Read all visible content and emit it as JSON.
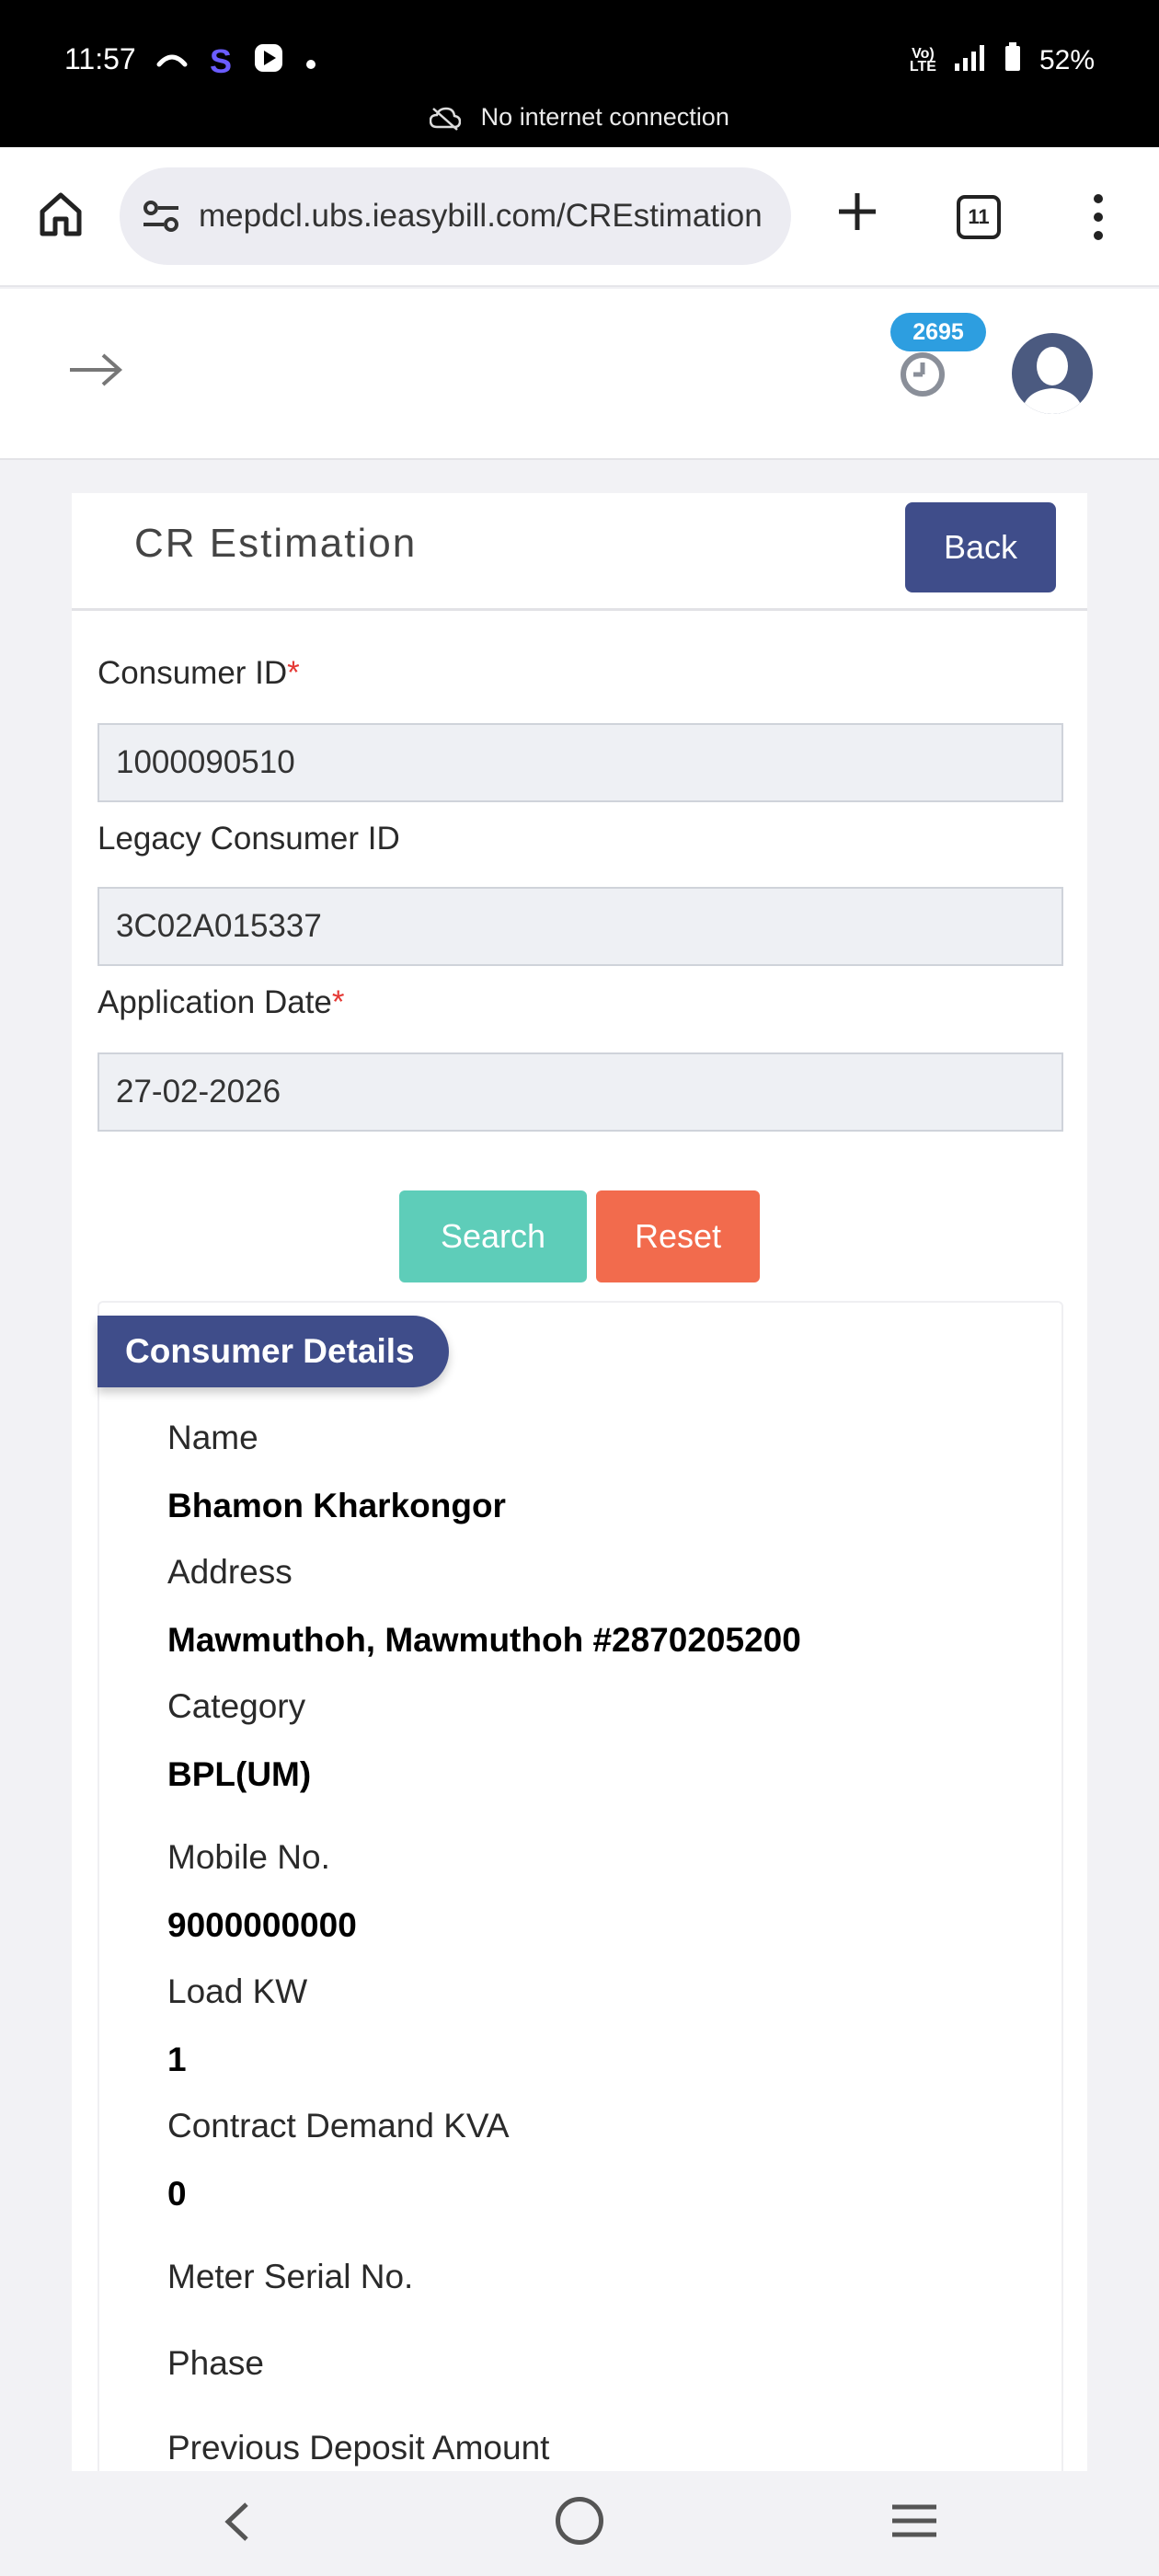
{
  "status_bar": {
    "time": "11:57",
    "battery": "52%",
    "network_notice": "No internet connection",
    "lte": "Vo) LTE"
  },
  "browser": {
    "url": "mepdcl.ubs.ieasybill.com/CREstimation",
    "tab_count": "11"
  },
  "header": {
    "notification_count": "2695"
  },
  "page": {
    "title": "CR Estimation",
    "back_label": "Back"
  },
  "form": {
    "consumer_id": {
      "label": "Consumer ID",
      "required_mark": "*",
      "value": "1000090510"
    },
    "legacy_consumer_id": {
      "label": "Legacy Consumer ID",
      "value": "3C02A015337"
    },
    "application_date": {
      "label": "Application Date",
      "required_mark": "*",
      "value": "27-02-2026"
    },
    "search_label": "Search",
    "reset_label": "Reset"
  },
  "consumer_details": {
    "heading": "Consumer Details",
    "fields": [
      {
        "label": "Name",
        "value": "Bhamon Kharkongor"
      },
      {
        "label": "Address",
        "value": "Mawmuthoh, Mawmuthoh #2870205200"
      },
      {
        "label": "Category",
        "value": "BPL(UM)"
      },
      {
        "label": "Mobile No.",
        "value": "9000000000"
      },
      {
        "label": "Load KW",
        "value": "1"
      },
      {
        "label": "Contract Demand KVA",
        "value": "0"
      },
      {
        "label": "Meter Serial No.",
        "value": ""
      },
      {
        "label": "Phase",
        "value": ""
      },
      {
        "label": "Previous Deposit Amount",
        "value": ""
      }
    ]
  },
  "colors": {
    "primary": "#3f4d8a",
    "search": "#5ecdb9",
    "reset": "#f26b4d",
    "badge": "#2d9ee0",
    "required": "#e53935"
  }
}
